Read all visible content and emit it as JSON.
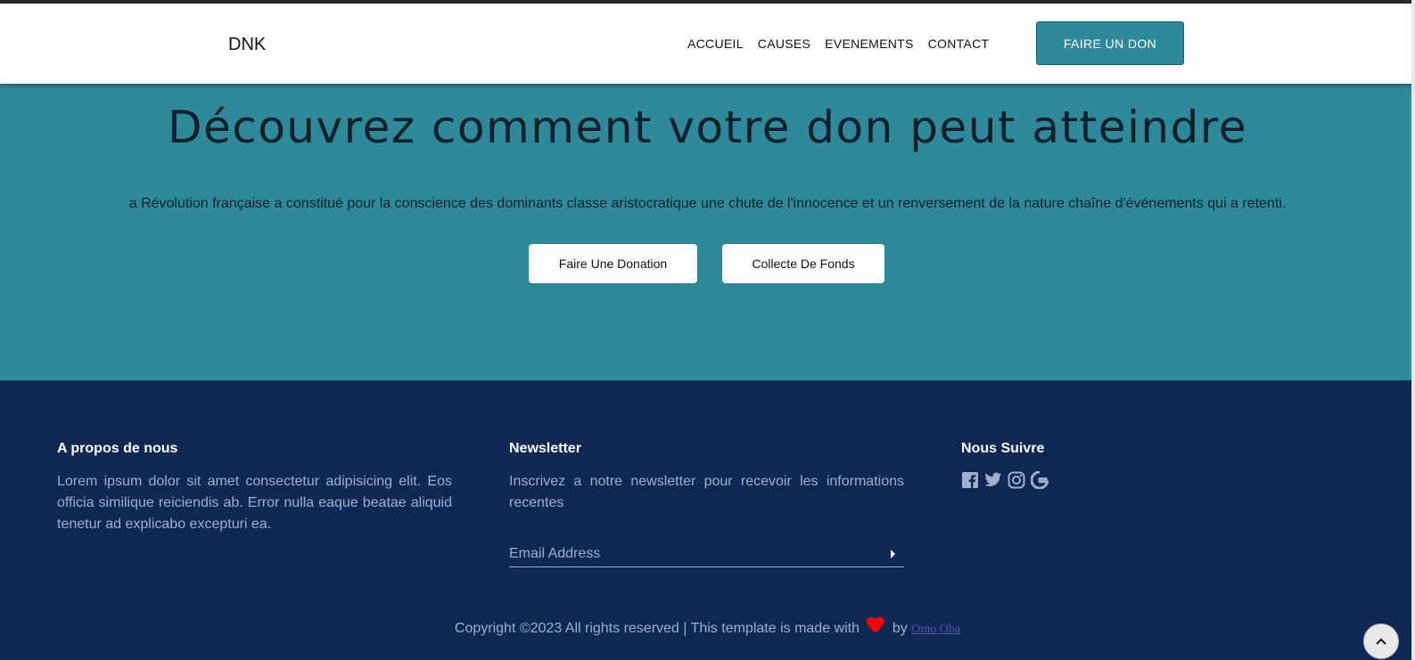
{
  "header": {
    "brand": "DNK",
    "nav": [
      "ACCUEIL",
      "CAUSES",
      "EVENEMENTS",
      "CONTACT"
    ],
    "donate_label": "FAIRE UN DON"
  },
  "hero": {
    "title": "Découvrez comment votre don peut atteindre",
    "text": "a Révolution française a constitué pour la conscience des dominants classe aristocratique une chute de l'innocence et un renversement de la nature chaîne d'événements qui a retenti.",
    "btn_donation": "Faire Une Donation",
    "btn_fundraise": "Collecte De Fonds"
  },
  "footer": {
    "about_title": "A propos de nous",
    "about_text": "Lorem ipsum dolor sit amet consectetur adipisicing elit. Eos officia similique reiciendis ab. Error nulla eaque beatae aliquid tenetur ad explicabo excepturi ea.",
    "newsletter_title": "Newsletter",
    "newsletter_text": "Inscrivez a notre newsletter pour recevoir les informations recentes",
    "email_placeholder": "Email Address",
    "follow_title": "Nous Suivre",
    "social_icons": [
      "facebook-icon",
      "twitter-icon",
      "instagram-icon",
      "google-icon"
    ],
    "copyright_prefix": "Copyright ©2023 All rights reserved | This template is made with",
    "copyright_by": "by",
    "author": "Omo Oba"
  },
  "colors": {
    "accent": "#2e8a9a",
    "footer_bg": "#0f2855",
    "heart": "#ff0000"
  }
}
